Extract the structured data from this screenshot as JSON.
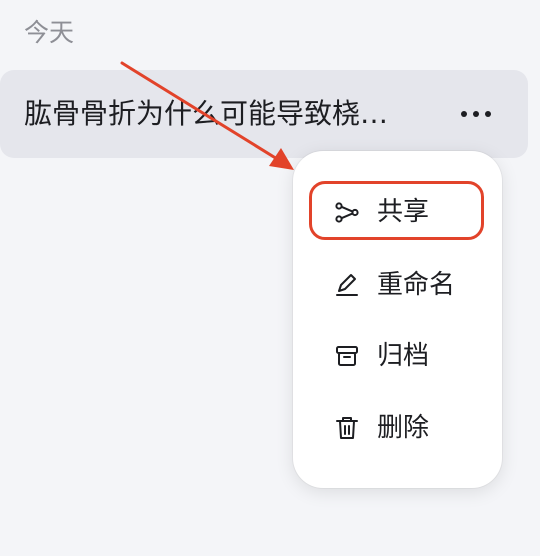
{
  "section": {
    "label": "今天"
  },
  "chat": {
    "title": "肱骨骨折为什么可能导致桡…",
    "more_icon": "more-horizontal-icon"
  },
  "menu": {
    "items": [
      {
        "label": "共享",
        "icon": "share-icon",
        "highlighted": true
      },
      {
        "label": "重命名",
        "icon": "edit-icon"
      },
      {
        "label": "归档",
        "icon": "archive-icon"
      },
      {
        "label": "删除",
        "icon": "trash-icon"
      }
    ]
  },
  "annotation": {
    "color": "#e2432a",
    "target": "share-menu-item"
  }
}
